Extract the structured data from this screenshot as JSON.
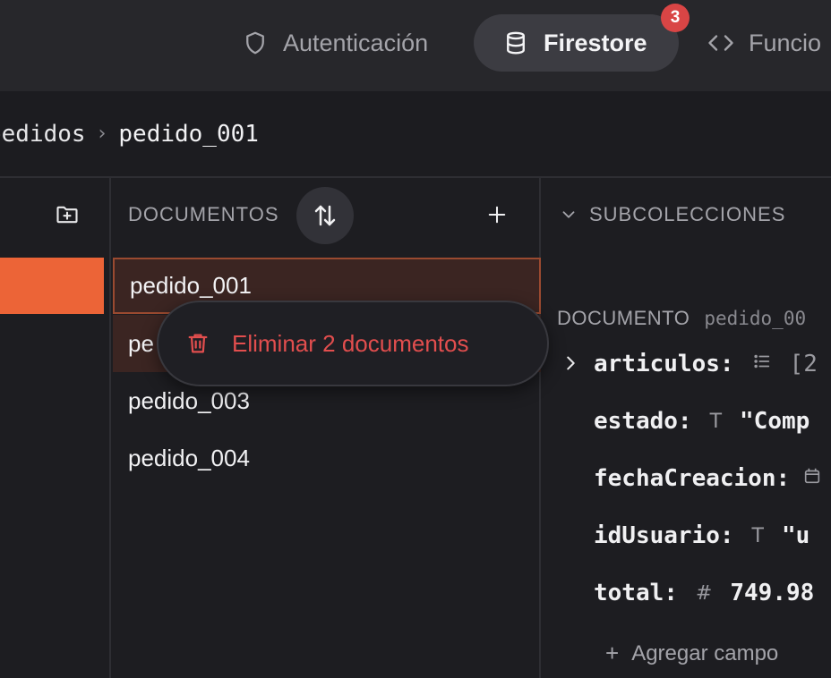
{
  "nav": {
    "tabs": [
      {
        "label": "Autenticación",
        "icon": "shield-icon"
      },
      {
        "label": "Firestore",
        "icon": "database-icon",
        "active": true,
        "badge": "3"
      },
      {
        "label": "Funcio",
        "icon": "code-icon"
      }
    ]
  },
  "breadcrumb": {
    "parent": "pedidos",
    "current": "pedido_001"
  },
  "documents": {
    "header": "DOCUMENTOS",
    "items": [
      "pedido_001",
      "pe",
      "pedido_003",
      "pedido_004"
    ]
  },
  "context_menu": {
    "delete_label": "Eliminar 2 documentos"
  },
  "detail": {
    "subcollections_header": "SUBCOLECCIONES",
    "document_label": "DOCUMENTO",
    "document_id": "pedido_00",
    "fields": [
      {
        "key": "articulos:",
        "type_icon": "list-icon",
        "value": "[2"
      },
      {
        "key": "estado:",
        "type_icon": "text-type-icon",
        "value": "\"Comp"
      },
      {
        "key": "fechaCreacion:",
        "type_icon": "calendar-icon",
        "value": ""
      },
      {
        "key": "idUsuario:",
        "type_icon": "text-type-icon",
        "value": "\"u"
      },
      {
        "key": "total:",
        "type_icon": "number-type-icon",
        "value": "749.98"
      }
    ],
    "add_field_label": "Agregar campo"
  },
  "colors": {
    "accent": "#ec6437",
    "danger": "#e24e4e",
    "badge": "#d94545"
  }
}
